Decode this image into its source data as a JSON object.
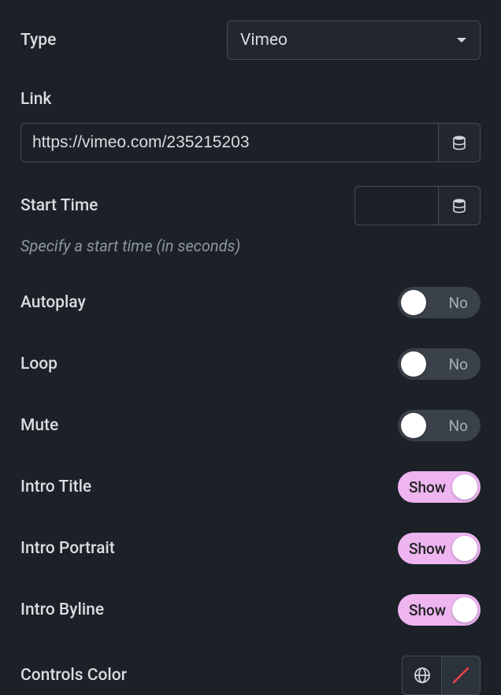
{
  "type": {
    "label": "Type",
    "value": "Vimeo"
  },
  "link": {
    "label": "Link",
    "value": "https://vimeo.com/235215203"
  },
  "startTime": {
    "label": "Start Time",
    "value": "",
    "hint": "Specify a start time (in seconds)"
  },
  "toggles": {
    "autoplay": {
      "label": "Autoplay",
      "state": "off",
      "text": "No"
    },
    "loop": {
      "label": "Loop",
      "state": "off",
      "text": "No"
    },
    "mute": {
      "label": "Mute",
      "state": "off",
      "text": "No"
    },
    "introTitle": {
      "label": "Intro Title",
      "state": "on",
      "text": "Show"
    },
    "introPortrait": {
      "label": "Intro Portrait",
      "state": "on",
      "text": "Show"
    },
    "introByline": {
      "label": "Intro Byline",
      "state": "on",
      "text": "Show"
    }
  },
  "controlsColor": {
    "label": "Controls Color"
  }
}
